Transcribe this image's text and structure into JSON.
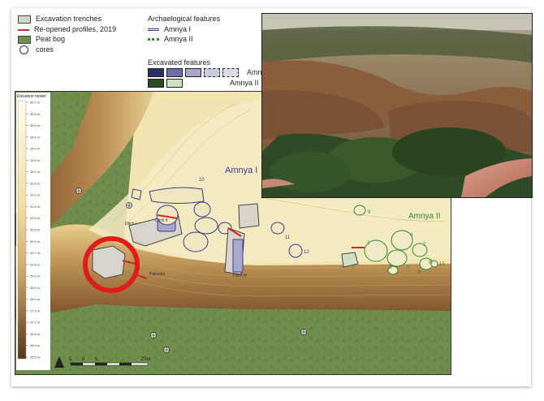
{
  "legend": {
    "excavation_trenches": "Excavation trenches",
    "reopened_profiles": "Re-opened profiles, 2019",
    "peat_bog": "Peat bog",
    "cores": "cores",
    "arch_features_title": "Archaelogical features",
    "amnya1": "Amnya I",
    "amnya2": "Amnya II",
    "excavated_title": "Excavated features",
    "exc_amnya1": "Amnya I",
    "exc_amnya2": "Amnya II"
  },
  "elevation": {
    "title": "Elevation model",
    "ticks": [
      "35.7 m",
      "35.5 m",
      "35.0 m",
      "34.5 m",
      "34.0 m",
      "33.5 m",
      "33.0 m",
      "32.5 m",
      "32.0 m",
      "31.5 m",
      "31.0 m",
      "30.5 m",
      "30.0 m",
      "29.7 m",
      "29.5 m",
      "29.0 m",
      "28.5 m",
      "28.0 m",
      "27.5 m",
      "27.0 m",
      "26.5 m",
      "26.0 m",
      "25.5 m"
    ]
  },
  "map": {
    "site_amnya1": "Amnya I",
    "site_amnya2": "Amnya II",
    "ditch1": "Ditch I",
    "ditch2": "Ditch II",
    "ditch3": "Ditch III",
    "palisade": "Palisade",
    "features_a1": [
      "10",
      "11",
      "12"
    ],
    "features_a2": [
      "1",
      "2",
      "3",
      "4",
      "5",
      "6",
      "7",
      "8",
      "9",
      "10"
    ],
    "scale_ticks": [
      "5",
      "0",
      "5",
      "25m"
    ],
    "north_icon": "north-arrow-icon"
  },
  "colors": {
    "trench_fill": "#d8d3cb",
    "profile_red": "#d0262a",
    "bog_green": "#6f8d4c",
    "amnya1_line": "#3b3d8c",
    "amnya2_line": "#2f8a34",
    "circle_red": "#e01b1b"
  }
}
